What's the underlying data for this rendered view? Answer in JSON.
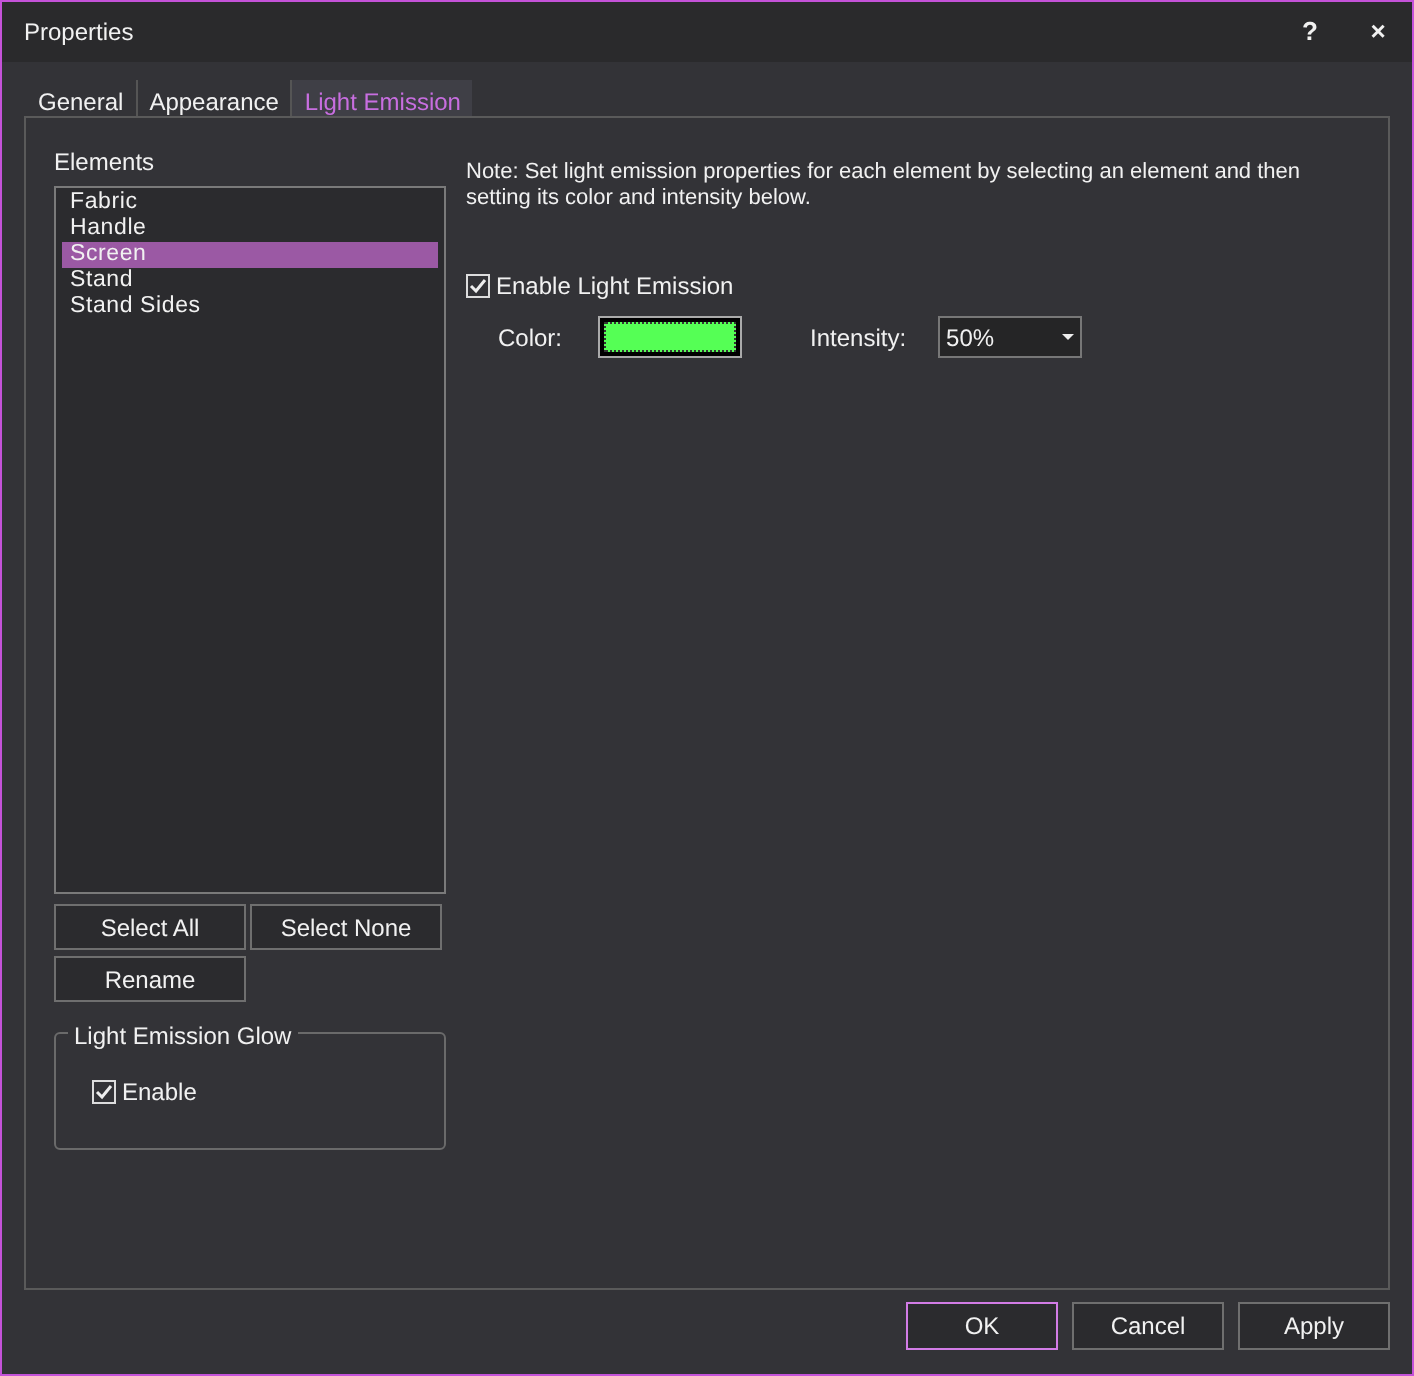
{
  "window": {
    "title": "Properties",
    "help": "?",
    "close": "×"
  },
  "tabs": [
    {
      "label": "General",
      "selected": false
    },
    {
      "label": "Appearance",
      "selected": false
    },
    {
      "label": "Light Emission",
      "selected": true
    }
  ],
  "elements": {
    "label": "Elements",
    "items": [
      {
        "label": "Fabric",
        "selected": false
      },
      {
        "label": "Handle",
        "selected": false
      },
      {
        "label": "Screen",
        "selected": true
      },
      {
        "label": "Stand",
        "selected": false
      },
      {
        "label": "Stand Sides",
        "selected": false
      }
    ]
  },
  "list_buttons": [
    "Select All",
    "Select None",
    "Rename"
  ],
  "glow": {
    "title": "Light Emission Glow",
    "enable": {
      "label": "Enable",
      "checked": true
    }
  },
  "note": "Note: Set light emission properties for each element by selecting an element and then setting its color and intensity below.",
  "enable_emission": {
    "label": "Enable Light Emission",
    "checked": true
  },
  "color": {
    "label": "Color:",
    "color": "#55ff55"
  },
  "intensity": {
    "label": "Intensity:",
    "value": "50%"
  },
  "buttons": [
    {
      "label": "OK",
      "default": true
    },
    {
      "label": "Cancel",
      "default": false
    },
    {
      "label": "Apply",
      "default": false
    }
  ]
}
